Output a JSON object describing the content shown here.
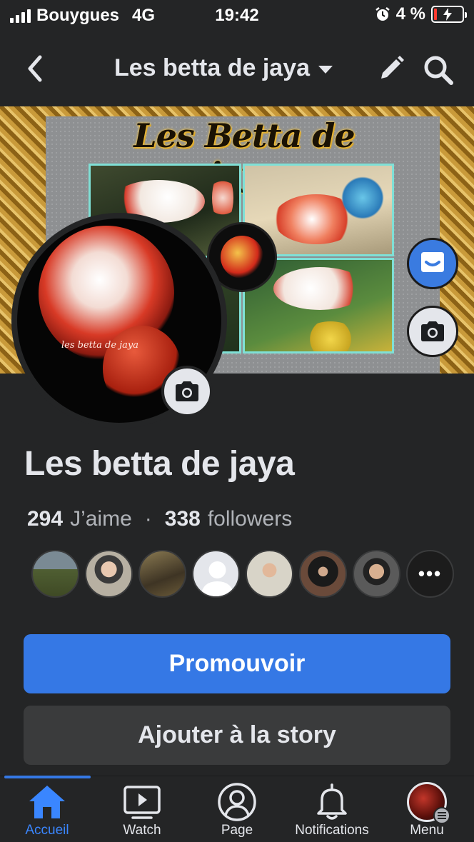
{
  "status_bar": {
    "carrier": "Bouygues",
    "network": "4G",
    "time": "19:42",
    "battery": "4 %"
  },
  "header": {
    "title": "Les betta de jaya"
  },
  "cover": {
    "title": "Les Betta de jaya",
    "profile_caption": "les betta de jaya"
  },
  "page": {
    "name": "Les betta de jaya",
    "likes_count": "294",
    "likes_label": "J’aime",
    "separator": "·",
    "followers_count": "338",
    "followers_label": "followers",
    "more_avatars": "•••"
  },
  "actions": {
    "promote": "Promouvoir",
    "add_story": "Ajouter à la story"
  },
  "tabs": [
    {
      "label": "Accueil",
      "icon": "home-icon",
      "active": true
    },
    {
      "label": "Watch",
      "icon": "watch-icon"
    },
    {
      "label": "Page",
      "icon": "page-profile-icon"
    },
    {
      "label": "Notifications",
      "icon": "bell-icon"
    },
    {
      "label": "Menu",
      "icon": "menu-avatar"
    }
  ],
  "colors": {
    "background": "#242526",
    "accent": "#3578e5",
    "text": "#e4e6eb",
    "secondary_text": "#b0b3b8"
  }
}
